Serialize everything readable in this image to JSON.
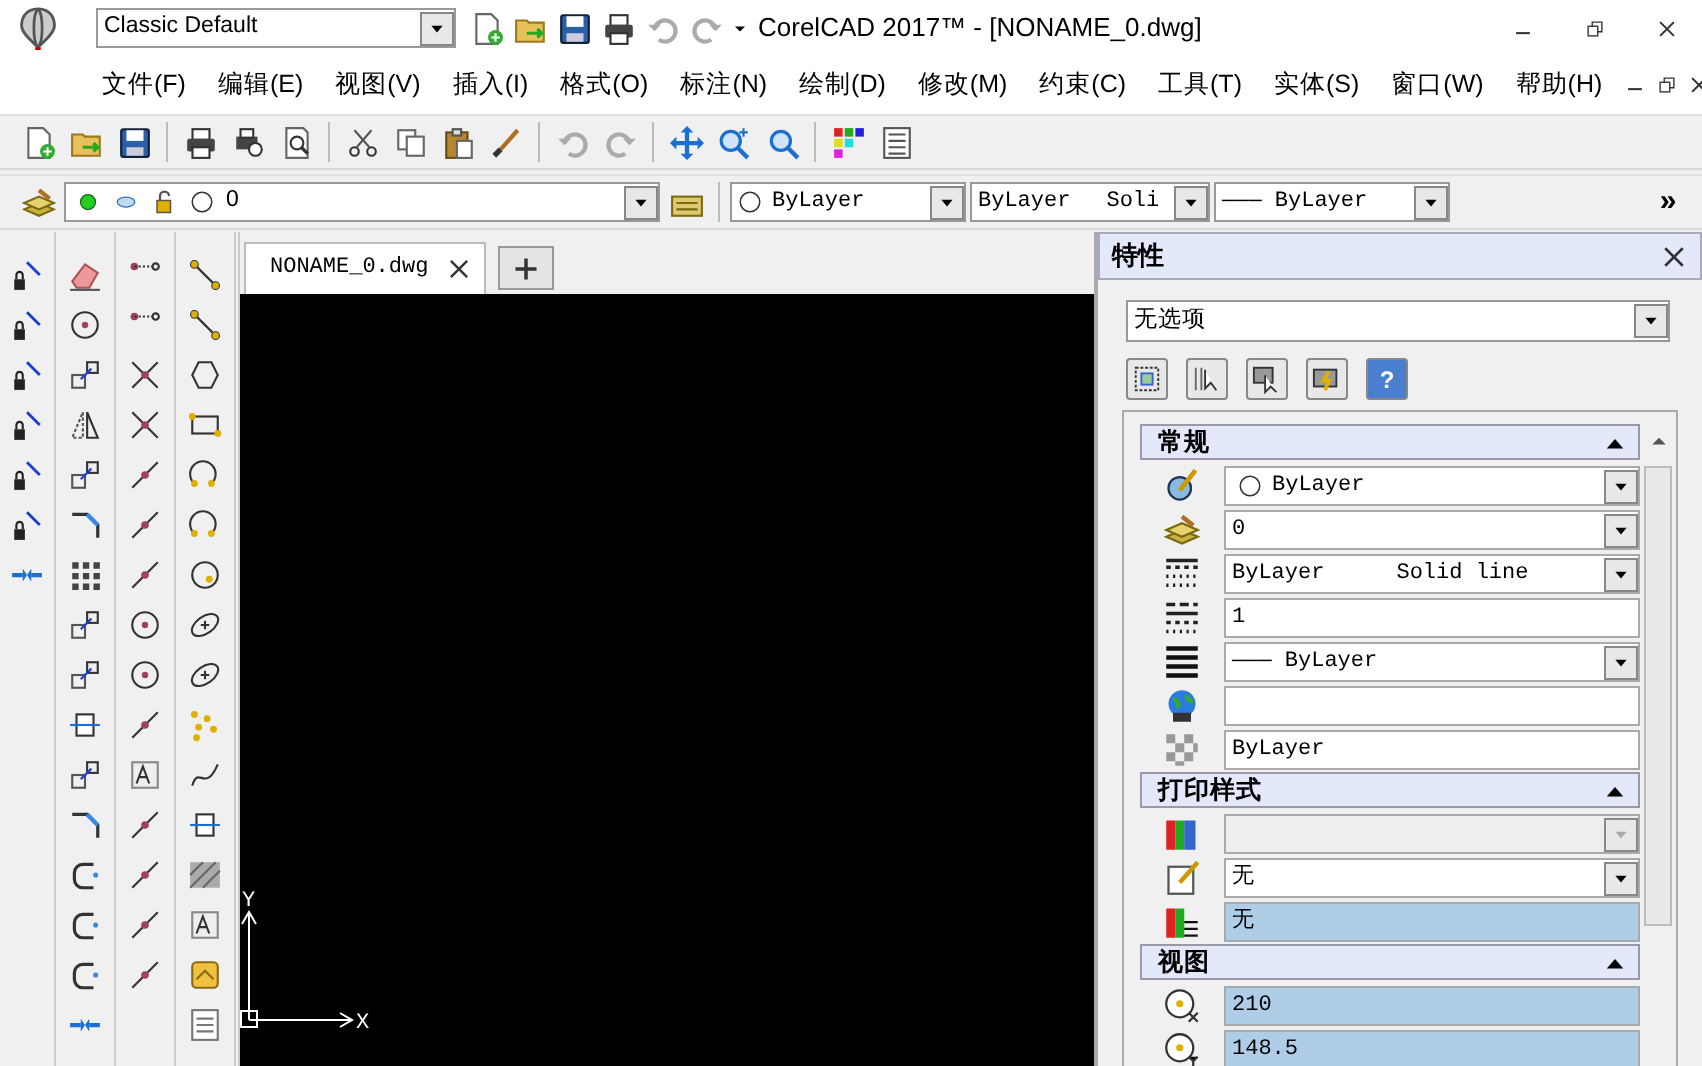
{
  "window": {
    "workspace": "Classic Default",
    "title": "CorelCAD 2017™ - [NONAME_0.dwg]"
  },
  "menu": [
    "文件(F)",
    "编辑(E)",
    "视图(V)",
    "插入(I)",
    "格式(O)",
    "标注(N)",
    "绘制(D)",
    "修改(M)",
    "约束(C)",
    "工具(T)",
    "实体(S)",
    "窗口(W)",
    "帮助(H)"
  ],
  "layer_bar": {
    "layer": "0",
    "color_value": "ByLayer",
    "linetype": "ByLayer",
    "linetype_name": "Soli",
    "lineweight": "——— ByLayer",
    "more": "»"
  },
  "document_tabs": [
    {
      "label": "NONAME_0.dwg",
      "selected": true
    }
  ],
  "canvas": {
    "y_axis": "Y",
    "x_axis": "X"
  },
  "properties": {
    "title": "特性",
    "selection": "无选项",
    "help_button": "?",
    "sections": [
      {
        "title": "常规",
        "expanded": true,
        "rows": [
          {
            "kind": "combo",
            "value": "ByLayer",
            "swatch": true
          },
          {
            "kind": "combo",
            "value": "0"
          },
          {
            "kind": "combo",
            "value": "ByLayer",
            "value_2": "Solid line"
          },
          {
            "kind": "text",
            "value": "1"
          },
          {
            "kind": "combo",
            "value": "——— ByLayer"
          },
          {
            "kind": "text"
          },
          {
            "kind": "text",
            "value": "ByLayer"
          }
        ]
      },
      {
        "title": "打印样式",
        "expanded": true,
        "rows": [
          {
            "kind": "combo",
            "disabled": true
          },
          {
            "kind": "combo",
            "value": "无"
          },
          {
            "kind": "text",
            "value": "无",
            "highlighted": true
          }
        ]
      },
      {
        "title": "视图",
        "expanded": true,
        "rows": [
          {
            "kind": "text",
            "value": "210",
            "highlighted": true
          },
          {
            "kind": "text",
            "value": "148.5",
            "highlighted": true
          }
        ]
      }
    ]
  }
}
